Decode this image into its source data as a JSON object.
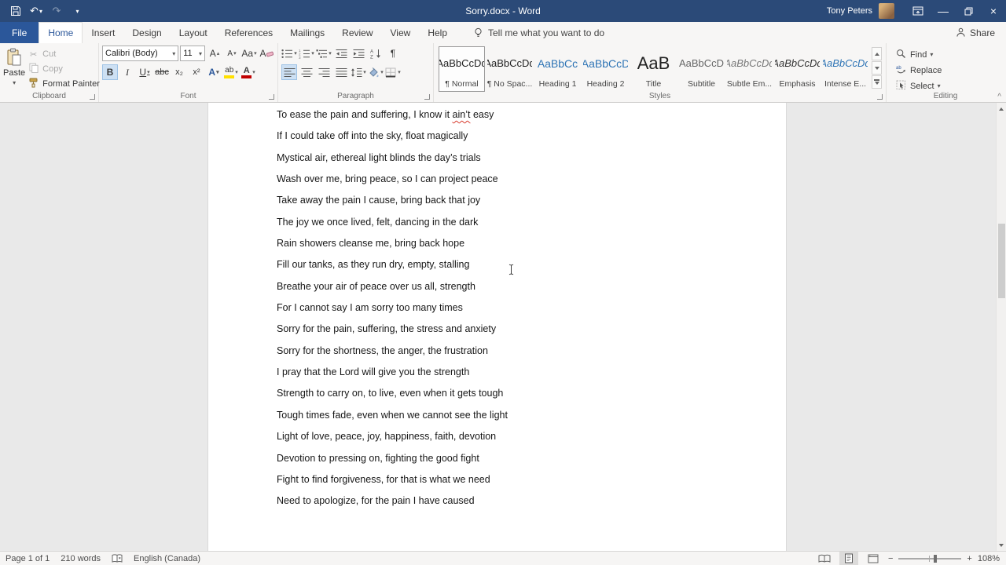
{
  "colors": {
    "titlebar": "#2b4a78",
    "accent": "#2b579a",
    "heading_blue": "#2e74b5",
    "squiggle_red": "#d83b2e"
  },
  "titlebar": {
    "title": "Sorry.docx - Word",
    "user": "Tony Peters"
  },
  "tabs": {
    "items": [
      {
        "label": "File",
        "file": true
      },
      {
        "label": "Home",
        "active": true
      },
      {
        "label": "Insert"
      },
      {
        "label": "Design"
      },
      {
        "label": "Layout"
      },
      {
        "label": "References"
      },
      {
        "label": "Mailings"
      },
      {
        "label": "Review"
      },
      {
        "label": "View"
      },
      {
        "label": "Help"
      }
    ],
    "tellme": "Tell me what you want to do",
    "share": "Share"
  },
  "ribbon": {
    "clipboard": {
      "label": "Clipboard",
      "paste": "Paste",
      "cut": "Cut",
      "copy": "Copy",
      "format_painter": "Format Painter"
    },
    "font": {
      "label": "Font",
      "name": "Calibri (Body)",
      "size": "11",
      "grow": "A",
      "shrink": "A",
      "case": "Aa",
      "clear": "A",
      "bold": "B",
      "italic": "I",
      "underline": "U",
      "strikethrough": "abc",
      "subscript": "x₂",
      "superscript": "x²",
      "effects": "A",
      "highlight": "ab",
      "color": "A"
    },
    "paragraph": {
      "label": "Paragraph"
    },
    "styles": {
      "label": "Styles",
      "items": [
        {
          "preview": "AaBbCcDd",
          "name": "¶ Normal",
          "cls": "normal",
          "selected": true
        },
        {
          "preview": "AaBbCcDd",
          "name": "¶ No Spac...",
          "cls": "normal"
        },
        {
          "preview": "AaBbCc",
          "name": "Heading 1",
          "cls": "heading"
        },
        {
          "preview": "AaBbCcD",
          "name": "Heading 2",
          "cls": "heading"
        },
        {
          "preview": "AaB",
          "name": "Title",
          "cls": "title"
        },
        {
          "preview": "AaBbCcD",
          "name": "Subtitle",
          "cls": "subtitle"
        },
        {
          "preview": "AaBbCcDd",
          "name": "Subtle Em...",
          "cls": "subtle"
        },
        {
          "preview": "AaBbCcDd",
          "name": "Emphasis",
          "cls": "emphasis"
        },
        {
          "preview": "AaBbCcDd",
          "name": "Intense E...",
          "cls": "intense"
        }
      ]
    },
    "editing": {
      "label": "Editing",
      "find": "Find",
      "replace": "Replace",
      "select": "Select"
    }
  },
  "document": {
    "misspelled_word": "ain’t",
    "lines": [
      "To ease the pain and suffering, I know it ain’t easy",
      "If I could take off into the sky, float magically",
      "Mystical air, ethereal light blinds the day’s trials",
      "Wash over me, bring peace, so I can project peace",
      "Take away the pain I cause, bring back that joy",
      "The joy we once lived, felt, dancing in the dark",
      "Rain showers cleanse me, bring back hope",
      "Fill our tanks, as they run dry, empty, stalling",
      "Breathe your air of peace over us all, strength",
      "For I cannot say I am sorry too many times",
      "Sorry for the pain, suffering, the stress and anxiety",
      "Sorry for the shortness, the anger, the frustration",
      "I pray that the Lord will give you the strength",
      "Strength to carry on, to live, even when it gets tough",
      "Tough times fade, even when we cannot see the light",
      "Light of love, peace, joy, happiness, faith, devotion",
      "Devotion to pressing on, fighting the good fight",
      "Fight to find forgiveness, for that is what we need",
      "Need to apologize, for the pain I have caused"
    ]
  },
  "statusbar": {
    "page": "Page 1 of 1",
    "words": "210 words",
    "language": "English (Canada)",
    "zoom": "108%"
  },
  "icons": {
    "undo": "↶",
    "redo": "↷",
    "dropdown": "▾",
    "up_small": "▴",
    "cut": "✂",
    "pilcrow": "¶",
    "close": "×",
    "minimize": "—",
    "collapse": "^",
    "zoom_out": "−",
    "zoom_in": "+"
  }
}
